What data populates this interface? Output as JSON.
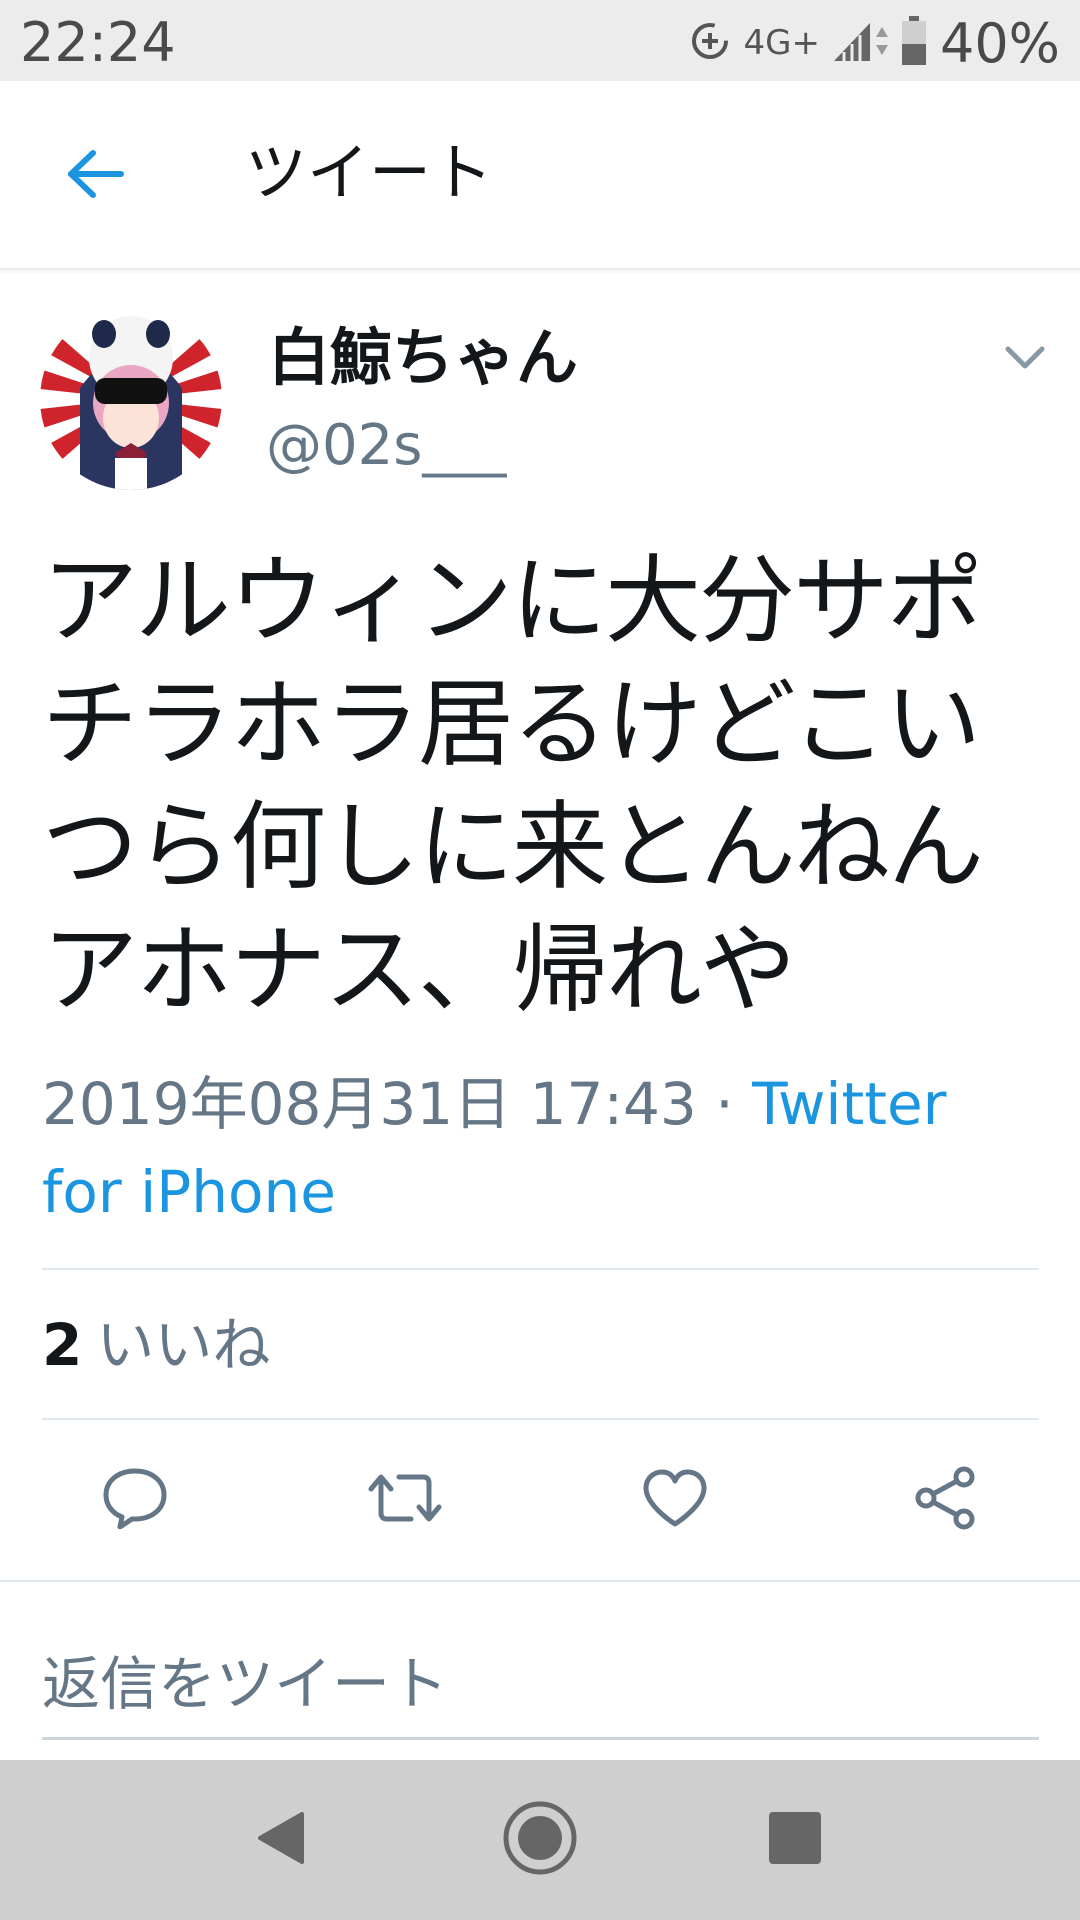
{
  "status_bar": {
    "time": "22:24",
    "network": "4G+",
    "battery": "40%"
  },
  "header": {
    "title": "ツイート"
  },
  "tweet": {
    "author_name": "白鯨ちゃん",
    "author_handle": "@02s___",
    "text_lines": [
      "アルウィンに大分サポ",
      "チラホラ居るけどこい",
      "つら何しに来とんねん",
      "アホナス、帰れや"
    ],
    "datetime": "2019年08月31日 17:43",
    "separator": " · ",
    "source": "Twitter for iPhone",
    "likes_count": "2",
    "likes_label": "いいね"
  },
  "reply": {
    "placeholder": "返信をツイート"
  },
  "colors": {
    "accent": "#1b95e0",
    "secondary_text": "#657786",
    "primary_text": "#14171a"
  },
  "icons": {
    "back": "arrow-left-icon",
    "menu": "chevron-down-icon",
    "reply": "comment-icon",
    "retweet": "retweet-icon",
    "like": "heart-icon",
    "share": "share-icon"
  }
}
